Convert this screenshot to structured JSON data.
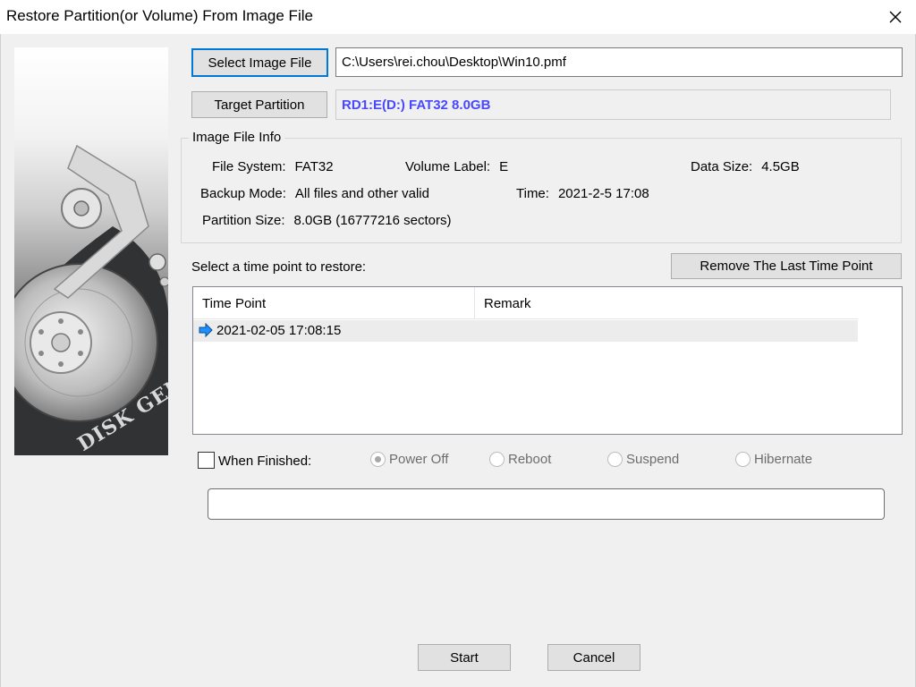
{
  "window": {
    "title": "Restore Partition(or Volume) From Image File",
    "close_glyph": "✕"
  },
  "banner": {
    "brand_text": "DISK GENIUS"
  },
  "image_file": {
    "button_label": "Select Image File",
    "path_value": "C:\\Users\\rei.chou\\Desktop\\Win10.pmf"
  },
  "target": {
    "button_label": "Target Partition",
    "value": "RD1:E(D:) FAT32 8.0GB",
    "value_color": "#4848ff"
  },
  "image_info": {
    "group_title": "Image File Info",
    "file_system_label": "File System:",
    "file_system_value": "FAT32",
    "volume_label_label": "Volume Label:",
    "volume_label_value": "E",
    "data_size_label": "Data Size:",
    "data_size_value": "4.5GB",
    "backup_mode_label": "Backup Mode:",
    "backup_mode_value": "All files and other valid",
    "time_label": "Time:",
    "time_value": "2021-2-5 17:08",
    "partition_size_label": "Partition Size:",
    "partition_size_value": "8.0GB  (16777216 sectors)"
  },
  "time_points": {
    "prompt": "Select a time point to restore:",
    "remove_button_label": "Remove The Last Time Point",
    "columns": [
      "Time Point",
      "Remark"
    ],
    "rows": [
      {
        "time_point": "2021-02-05 17:08:15",
        "remark": ""
      }
    ]
  },
  "finish": {
    "checkbox_label": "When Finished:",
    "checked": false,
    "options": [
      "Power Off",
      "Reboot",
      "Suspend",
      "Hibernate"
    ],
    "selected": "Power Off"
  },
  "progress": {
    "value": 0
  },
  "footer": {
    "start_label": "Start",
    "cancel_label": "Cancel"
  },
  "colors": {
    "accent": "#0078d7",
    "dialog_bg": "#f0f0f0",
    "list_arrow": "#1e90ff"
  }
}
